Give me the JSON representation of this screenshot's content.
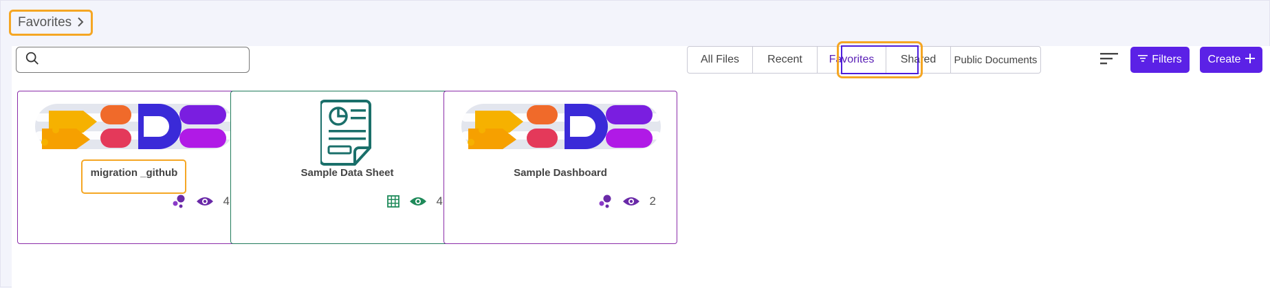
{
  "breadcrumb": {
    "label": "Favorites"
  },
  "search": {
    "value": "",
    "placeholder": ""
  },
  "tabs": [
    {
      "label": "All Files"
    },
    {
      "label": "Recent"
    },
    {
      "label": "Favorites",
      "active": true
    },
    {
      "label": "Shared"
    },
    {
      "label": "Public Documents"
    }
  ],
  "toolbar": {
    "filters_label": "Filters",
    "create_label": "Create"
  },
  "cards": [
    {
      "title": "migration _github",
      "type_icon": "flow-dots-icon",
      "views": "4",
      "thumbnail": "colorful-logo"
    },
    {
      "title": "Sample Data Sheet",
      "type_icon": "grid-icon",
      "views": "4",
      "thumbnail": "datasheet-document"
    },
    {
      "title": "Sample Dashboard",
      "type_icon": "flow-dots-icon",
      "views": "2",
      "thumbnail": "colorful-logo"
    }
  ],
  "colors": {
    "accent": "#5b21e6",
    "highlight": "#f5a623",
    "purple_border": "#8a2aa8",
    "green": "#1f7a5a"
  }
}
